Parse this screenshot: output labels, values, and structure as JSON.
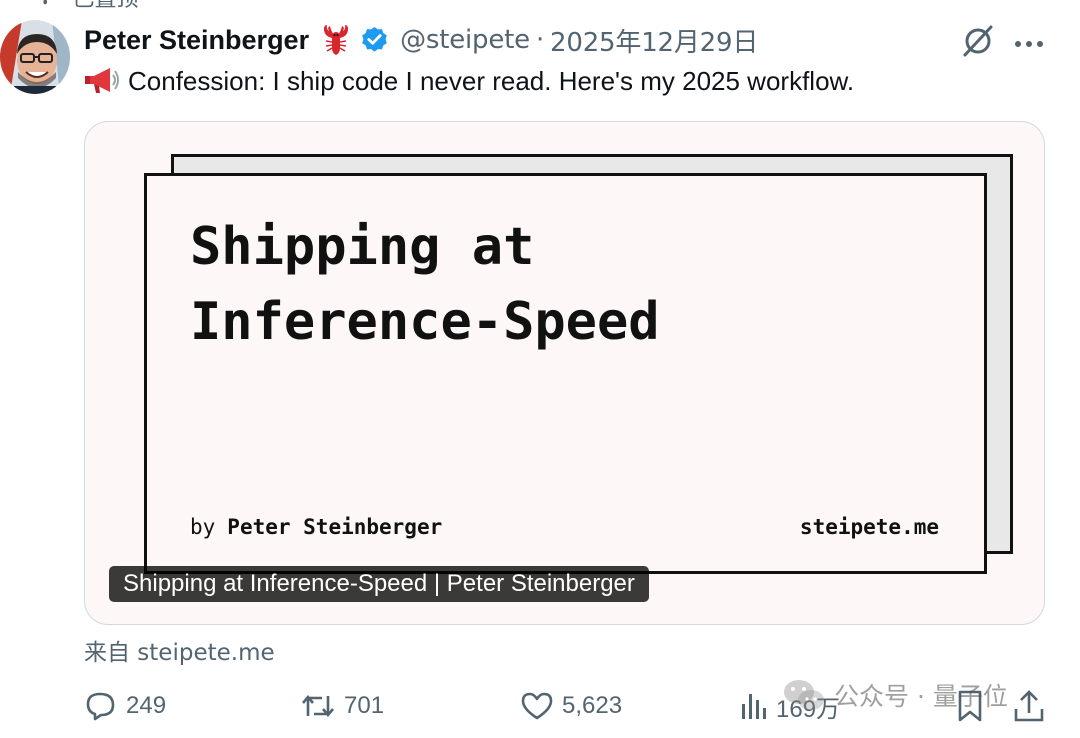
{
  "pinned_label": "已置顶",
  "author": {
    "name": "Peter Steinberger",
    "handle": "@steipete",
    "date": "2025年12月29日"
  },
  "tweet_text": "Confession: I ship code I never read. Here's my 2025 workflow.",
  "card": {
    "title": "Shipping at\nInference-Speed",
    "by_prefix": "by",
    "by_name": "Peter Steinberger",
    "domain": "steipete.me",
    "caption": "Shipping at Inference-Speed | Peter Steinberger"
  },
  "source_line": "来自 steipete.me",
  "actions": {
    "replies": "249",
    "reposts": "701",
    "likes": "5,623",
    "views": "169万"
  },
  "watermark": "公众号 · 量子位",
  "colors": {
    "text": "#0f1419",
    "muted": "#536471",
    "verified": "#1d9bf0",
    "card_bg": "#fdf8f7",
    "border": "#cfd9de"
  },
  "icons": [
    "pin-icon",
    "lobster-emoji-icon",
    "verified-badge-icon",
    "grok-icon",
    "more-icon",
    "megaphone-emoji-icon",
    "reply-icon",
    "repost-icon",
    "like-icon",
    "views-icon",
    "bookmark-icon",
    "share-icon",
    "wechat-icon"
  ]
}
